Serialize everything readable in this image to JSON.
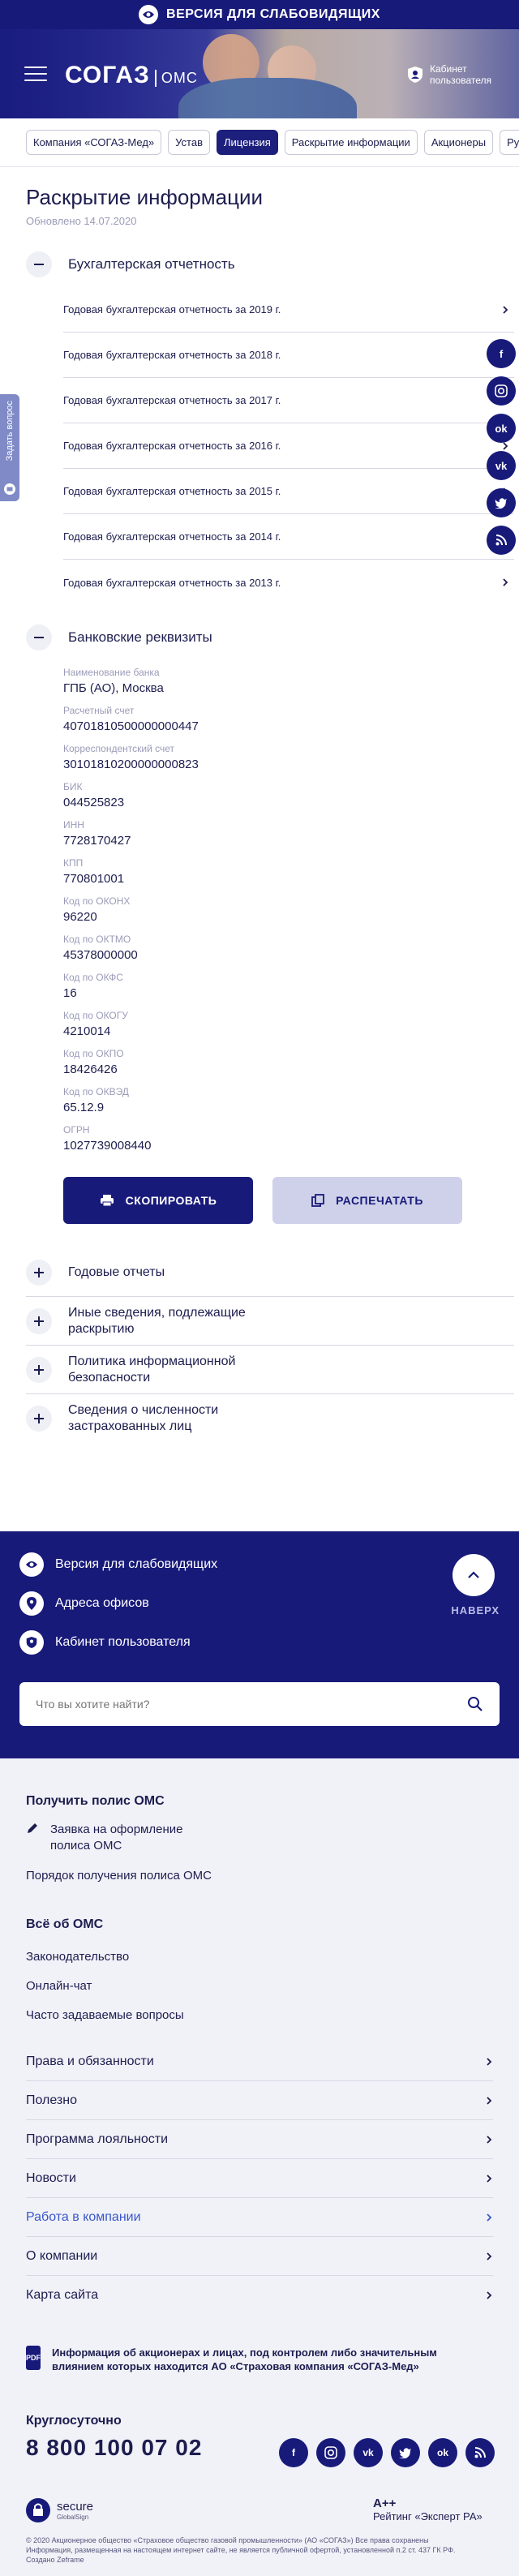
{
  "topbar": {
    "label": "ВЕРСИЯ ДЛЯ СЛАБОВИДЯЩИХ"
  },
  "header": {
    "logo_main": "СОГАЗ",
    "logo_sub": "ОМС",
    "cabinet_label": "Кабинет пользователя"
  },
  "tabs": [
    {
      "label": "Компания «СОГАЗ-Мед»",
      "active": false
    },
    {
      "label": "Устав",
      "active": false
    },
    {
      "label": "Лицензия",
      "active": true
    },
    {
      "label": "Раскрытие информации",
      "active": false
    },
    {
      "label": "Акционеры",
      "active": false
    },
    {
      "label": "Руководство",
      "active": false
    }
  ],
  "page": {
    "title": "Раскрытие информации",
    "updated": "Обновлено 14.07.2020"
  },
  "accounting": {
    "title": "Бухгалтерская отчетность",
    "items": [
      "Годовая бухгалтерская отчетность за 2019 г.",
      "Годовая бухгалтерская отчетность за 2018 г.",
      "Годовая бухгалтерская отчетность за 2017 г.",
      "Годовая бухгалтерская отчетность за 2016 г.",
      "Годовая бухгалтерская отчетность за 2015 г.",
      "Годовая бухгалтерская отчетность за 2014 г.",
      "Годовая бухгалтерская отчетность за 2013 г."
    ]
  },
  "bank": {
    "title": "Банковские реквизиты",
    "fields": [
      {
        "label": "Наименование банка",
        "value": "ГПБ (АО), Москва"
      },
      {
        "label": "Расчетный счет",
        "value": "40701810500000000447"
      },
      {
        "label": "Корреспондентский счет",
        "value": "30101810200000000823"
      },
      {
        "label": "БИК",
        "value": "044525823"
      },
      {
        "label": "ИНН",
        "value": "7728170427"
      },
      {
        "label": "КПП",
        "value": "770801001"
      },
      {
        "label": "Код по ОКОНХ",
        "value": "96220"
      },
      {
        "label": "Код по ОКТМО",
        "value": "45378000000"
      },
      {
        "label": "Код по ОКФС",
        "value": "16"
      },
      {
        "label": "Код по ОКОГУ",
        "value": "4210014"
      },
      {
        "label": "Код по ОКПО",
        "value": "18426426"
      },
      {
        "label": "Код по ОКВЭД",
        "value": "65.12.9"
      },
      {
        "label": "ОГРН",
        "value": "1027739008440"
      }
    ],
    "copy_label": "СКОПИРОВАТЬ",
    "print_label": "РАСПЕЧАТАТЬ"
  },
  "collapsed_sections": [
    "Годовые отчеты",
    "Иные сведения, подлежащие раскрытию",
    "Политика информационной безопасности",
    "Сведения о численности застрахованных лиц"
  ],
  "feedback_tab": {
    "label": "Задать вопрос"
  },
  "footer_blue": {
    "low_vision": "Версия для слабовидящих",
    "offices": "Адреса офисов",
    "cabinet": "Кабинет пользователя",
    "up_label": "НАВЕРХ",
    "search_placeholder": "Что вы хотите найти?"
  },
  "footer": {
    "get_policy_title": "Получить полис ОМС",
    "policy_request": "Заявка на оформление полиса ОМС",
    "policy_order": "Порядок получения полиса ОМС",
    "all_about_title": "Всё об ОМС",
    "all_about_links": [
      "Законодательство",
      "Онлайн-чат",
      "Часто задаваемые вопросы"
    ],
    "menu": [
      {
        "label": "Права и обязанности",
        "highlight": false
      },
      {
        "label": "Полезно",
        "highlight": false
      },
      {
        "label": "Программа лояльности",
        "highlight": false
      },
      {
        "label": "Новости",
        "highlight": false
      },
      {
        "label": "Работа в компании",
        "highlight": true
      },
      {
        "label": "О компании",
        "highlight": false
      },
      {
        "label": "Карта сайта",
        "highlight": false
      }
    ],
    "pdf_badge": "PDF",
    "shareholders_info": "Информация об акционерах и лицах, под контролем либо значительным влиянием которых находится АО «Страховая компания «СОГАЗ-Мед»",
    "around_clock": "Круглосуточно",
    "phone": "8 800 100 07 02",
    "secure_label": "secure",
    "secure_sub": "GlobalSign",
    "rating_grade": "A++",
    "rating_label": "Рейтинг «Эксперт РА»",
    "legal_1": "© 2020 Акционерное общество «Страховое общество газовой промышленности» (АО «СОГАЗ») Все права сохранены",
    "legal_2": "Информация, размещенная на настоящем интернет сайте, не является публичной офертой, установленной п.2 ст. 437 ГК РФ.",
    "legal_3": "Создано Zeframe"
  },
  "colors": {
    "brand": "#181a7a",
    "accent": "#3a57c9",
    "bg_light": "#f1f2f8"
  }
}
